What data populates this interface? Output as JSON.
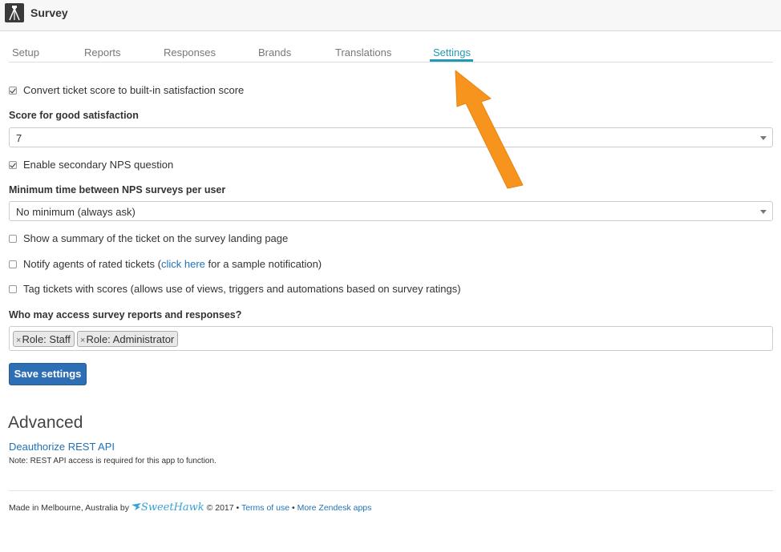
{
  "app": {
    "title": "Survey",
    "logo_icon": "tripod-icon"
  },
  "tabs": [
    {
      "label": "Setup"
    },
    {
      "label": "Reports"
    },
    {
      "label": "Responses"
    },
    {
      "label": "Brands"
    },
    {
      "label": "Translations"
    },
    {
      "label": "Settings",
      "active": true
    }
  ],
  "settings": {
    "convert_score": {
      "label": "Convert ticket score to built-in satisfaction score",
      "checked": true
    },
    "good_score": {
      "heading": "Score for good satisfaction",
      "value": "7"
    },
    "enable_nps": {
      "label": "Enable secondary NPS question",
      "checked": true
    },
    "nps_interval": {
      "heading": "Minimum time between NPS surveys per user",
      "value": "No minimum (always ask)"
    },
    "show_summary": {
      "label": "Show a summary of the ticket on the survey landing page",
      "checked": false
    },
    "notify_agents": {
      "label_before": "Notify agents of rated tickets (",
      "link": "click here",
      "label_after": " for a sample notification)",
      "checked": false
    },
    "tag_tickets": {
      "label": "Tag tickets with scores (allows use of views, triggers and automations based on survey ratings)",
      "checked": false
    },
    "access": {
      "heading": "Who may access survey reports and responses?",
      "tags": [
        {
          "remove": "×",
          "label": "Role: Staff"
        },
        {
          "remove": "×",
          "label": "Role: Administrator"
        }
      ]
    },
    "save_label": "Save settings"
  },
  "advanced": {
    "heading": "Advanced",
    "deauth_link": "Deauthorize REST API",
    "note": "Note: REST API access is required for this app to function."
  },
  "footer": {
    "made_in": "Made in Melbourne, Australia by",
    "brand": "SweetHawk",
    "copyright": "© 2017 •",
    "terms": "Terms of use",
    "sep": "•",
    "more_apps": "More Zendesk apps"
  },
  "colors": {
    "accent": "#1f9bb5",
    "link": "#1f73b7",
    "button": "#2e6eb5",
    "annotation_arrow": "#f7941d"
  }
}
